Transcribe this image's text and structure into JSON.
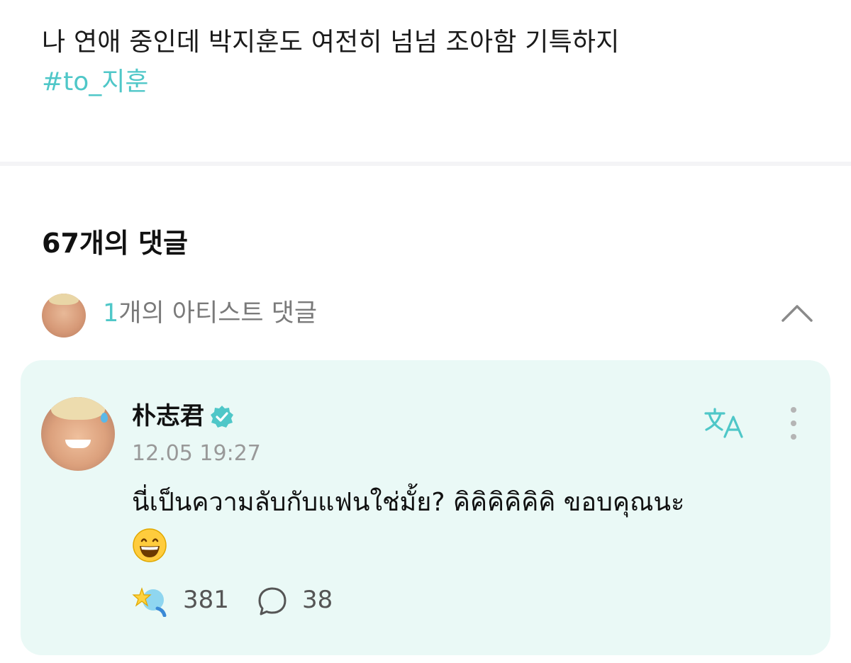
{
  "post": {
    "text": "나 연애 중인데 박지훈도 여전히 넘넘 조아함 기특하지",
    "hashtag": "#to_지훈"
  },
  "comments_header": {
    "title": "67개의 댓글"
  },
  "artist_comments": {
    "count": "1",
    "label": "개의 아티스트 댓글"
  },
  "comment": {
    "author": "朴志君",
    "timestamp": "12.05 19:27",
    "body": "นี่เป็นความลับกับแฟนใช่มั้ย? คิคิคิคิคิคิ ขอบคุณนะ",
    "likes": "381",
    "replies": "38"
  },
  "colors": {
    "accent": "#4fc7c8",
    "card_bg": "#eaf9f6",
    "muted_text": "#999999"
  },
  "icons": {
    "verified": "verified-badge-icon",
    "translate": "translate-icon",
    "more": "more-vertical-icon",
    "collapse": "chevron-up-icon",
    "like": "star-heart-icon",
    "reply": "comment-bubble-icon",
    "emoji": "grinning-face-emoji"
  }
}
